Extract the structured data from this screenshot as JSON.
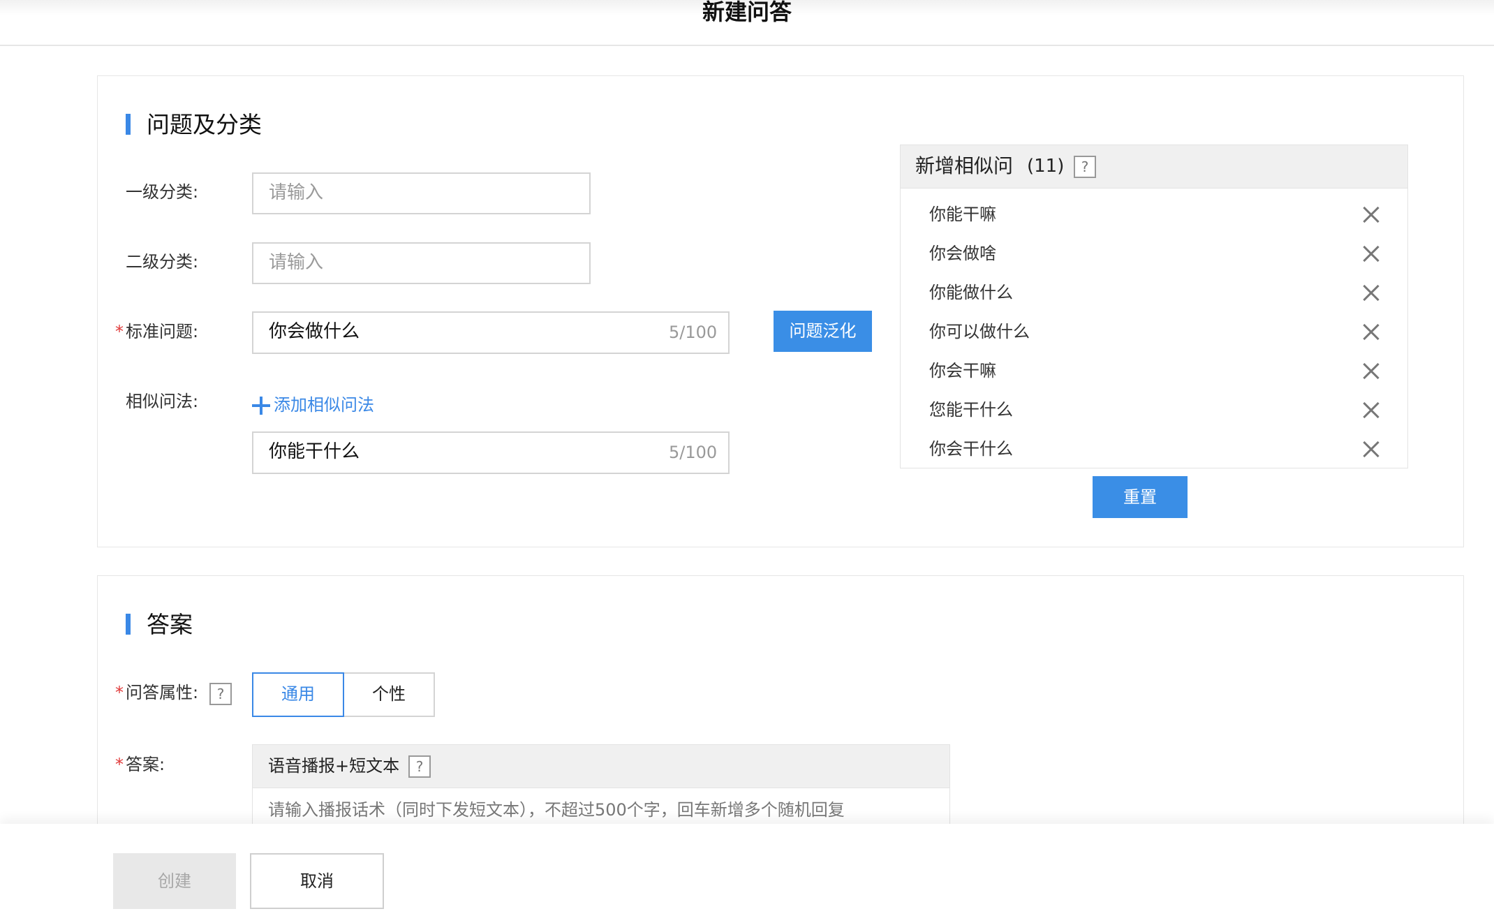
{
  "header": {
    "title": "新建问答"
  },
  "question_section": {
    "title": "问题及分类",
    "level1": {
      "label": "一级分类:",
      "placeholder": "请输入"
    },
    "level2": {
      "label": "二级分类:",
      "placeholder": "请输入"
    },
    "standard": {
      "required_mark": "*",
      "label": "标准问题:",
      "value": "你会做什么",
      "counter": "5/100",
      "generalize_button": "问题泛化"
    },
    "similar": {
      "label": "相似问法:",
      "add_link": "添加相似问法",
      "value": "你能干什么",
      "counter": "5/100"
    }
  },
  "similar_panel": {
    "title": "新增相似问",
    "count": "(11)",
    "help": "?",
    "items": [
      "你能干嘛",
      "你会做啥",
      "你能做什么",
      "你可以做什么",
      "你会干嘛",
      "您能干什么",
      "你会干什么"
    ],
    "reset_button": "重置"
  },
  "answer_section": {
    "title": "答案",
    "attr": {
      "required_mark": "*",
      "label": "问答属性:",
      "help": "?",
      "options": [
        "通用",
        "个性"
      ],
      "selected": "通用"
    },
    "answer": {
      "required_mark": "*",
      "label": "答案:",
      "type": "语音播报+短文本",
      "help": "?",
      "placeholder": "请输入播报话术（同时下发短文本），不超过500个字，回车新增多个随机回复"
    }
  },
  "footer": {
    "create_button": "创建",
    "cancel_button": "取消"
  },
  "colors": {
    "accent": "#3a88e6",
    "required": "#e03a3a",
    "disabled_bg": "#e8e8e8"
  }
}
